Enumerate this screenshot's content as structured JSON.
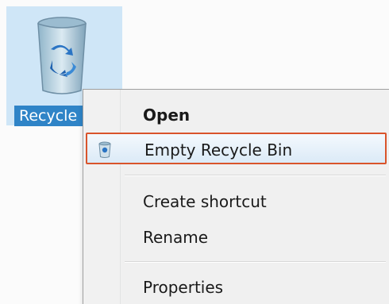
{
  "desktop": {
    "recycle_bin": {
      "label": "Recycle Bin",
      "icon": "recycle-bin-icon"
    }
  },
  "context_menu": {
    "items": [
      {
        "label": "Open",
        "bold": true
      },
      {
        "label": "Empty Recycle Bin",
        "icon": "recycle-bin-small-icon",
        "highlighted": true
      },
      {
        "label": "Create shortcut"
      },
      {
        "label": "Rename"
      },
      {
        "label": "Properties"
      }
    ],
    "highlight_border_color": "#d9542b",
    "selection_color": "#2f84c7"
  }
}
